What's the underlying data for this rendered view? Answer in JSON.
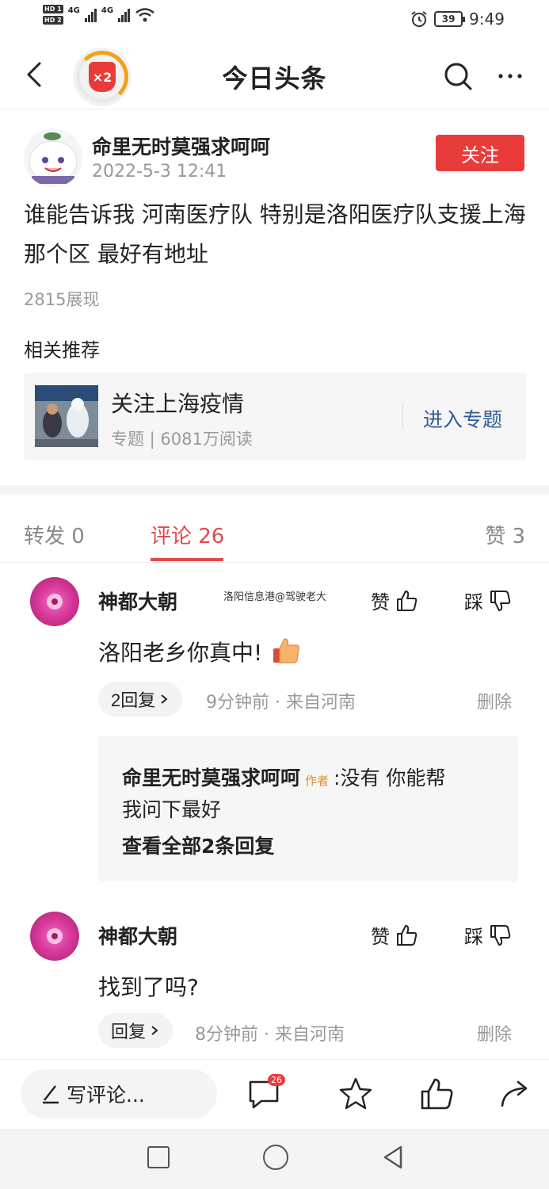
{
  "status_bar": {
    "hd1": "HD 1",
    "hd2": "HD 2",
    "net1": "4G",
    "net2": "4G",
    "battery": "39",
    "time": "9:49"
  },
  "nav": {
    "title": "今日头条",
    "badge": "×2"
  },
  "post": {
    "author": "命里无时莫强求呵呵",
    "time": "2022-5-3 12:41",
    "follow_label": "关注",
    "text": "谁能告诉我  河南医疗队   特别是洛阳医疗队支援上海那个区 最好有地址",
    "views": "2815展现"
  },
  "related": {
    "heading": "相关推荐",
    "topic": "关注上海疫情",
    "meta": "专题 | 6081万阅读",
    "enter_label": "进入专题"
  },
  "tabs": {
    "repost": "转发 0",
    "comment": "评论 26",
    "like": "赞 3"
  },
  "comments": [
    {
      "name": "神都大朝",
      "source": "洛阳信息港@驾驶老大",
      "like_label": "赞",
      "dislike_label": "踩",
      "text": "洛阳老乡你真中!",
      "reply_label": "2回复",
      "meta": "9分钟前 · 来自河南",
      "delete_label": "删除",
      "reply": {
        "author": "命里无时莫强求呵呵",
        "tag": "作者",
        "text1": ":没有 你能帮",
        "text2": "我问下最好",
        "view_all": "查看全部2条回复"
      }
    },
    {
      "name": "神都大朝",
      "like_label": "赞",
      "dislike_label": "踩",
      "text": "找到了吗?",
      "reply_label": "回复",
      "meta": "8分钟前 · 来自河南",
      "delete_label": "删除"
    }
  ],
  "bottom_bar": {
    "write_placeholder": "写评论...",
    "comment_count": "26"
  }
}
